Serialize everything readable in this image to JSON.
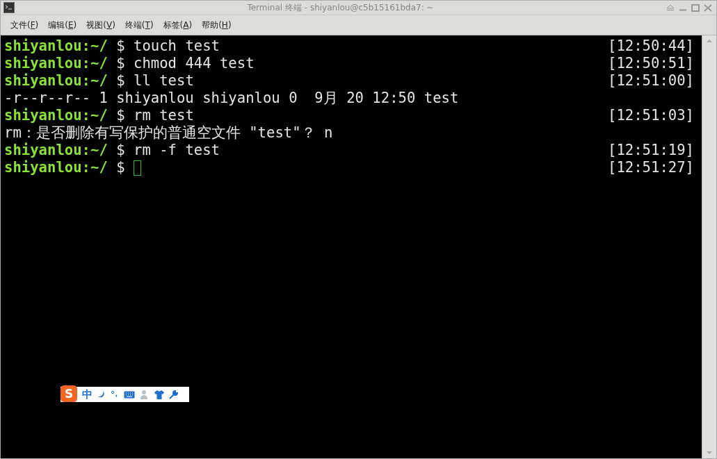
{
  "window": {
    "title": "Terminal 终端 - shiyanlou@c5b15161bda7: ~"
  },
  "menu": [
    "文件(F)",
    "编辑(E)",
    "视图(V)",
    "终端(T)",
    "标签(A)",
    "帮助(H)"
  ],
  "lines": [
    {
      "kind": "prompt",
      "user": "shiyanlou:~/",
      "sign": "$",
      "command": "touch test",
      "time": "[12:50:44]"
    },
    {
      "kind": "prompt",
      "user": "shiyanlou:~/",
      "sign": "$",
      "command": "chmod 444 test",
      "time": "[12:50:51]"
    },
    {
      "kind": "prompt",
      "user": "shiyanlou:~/",
      "sign": "$",
      "command": "ll test",
      "time": "[12:51:00]"
    },
    {
      "kind": "output",
      "text": "-r--r--r-- 1 shiyanlou shiyanlou 0  9月 20 12:50 test"
    },
    {
      "kind": "prompt",
      "user": "shiyanlou:~/",
      "sign": "$",
      "command": "rm test",
      "time": "[12:51:03]"
    },
    {
      "kind": "output",
      "text": "rm：是否删除有写保护的普通空文件 \"test\"？ n"
    },
    {
      "kind": "prompt",
      "user": "shiyanlou:~/",
      "sign": "$",
      "command": "rm -f test",
      "time": "[12:51:19]"
    },
    {
      "kind": "cursor",
      "user": "shiyanlou:~/",
      "sign": "$",
      "time": "[12:51:27]"
    }
  ],
  "ime_toolbar": {
    "logo": "S",
    "mode": "中"
  }
}
